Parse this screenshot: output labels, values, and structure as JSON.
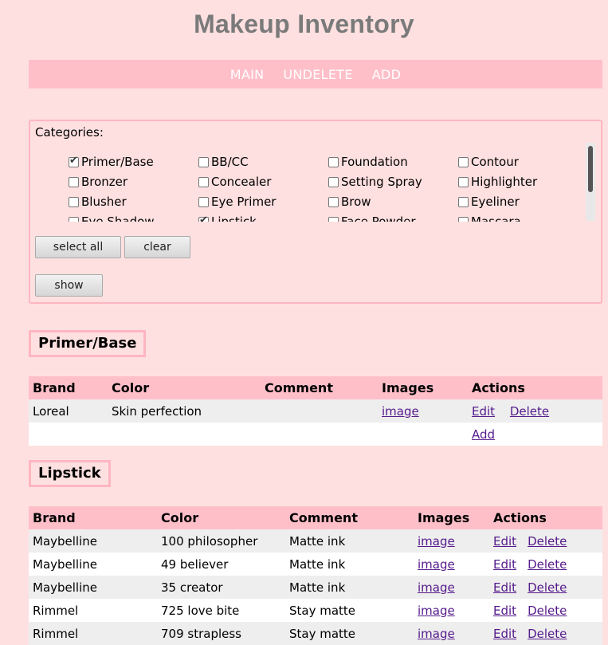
{
  "page": {
    "title": "Makeup Inventory"
  },
  "nav": {
    "items": [
      "MAIN",
      "UNDELETE",
      "ADD"
    ]
  },
  "categories": {
    "label": "Categories:",
    "items": [
      {
        "label": "Primer/Base",
        "checked": true
      },
      {
        "label": "BB/CC",
        "checked": false
      },
      {
        "label": "Foundation",
        "checked": false
      },
      {
        "label": "Contour",
        "checked": false
      },
      {
        "label": "Bronzer",
        "checked": false
      },
      {
        "label": "Concealer",
        "checked": false
      },
      {
        "label": "Setting Spray",
        "checked": false
      },
      {
        "label": "Highlighter",
        "checked": false
      },
      {
        "label": "Blusher",
        "checked": false
      },
      {
        "label": "Eye Primer",
        "checked": false
      },
      {
        "label": "Brow",
        "checked": false
      },
      {
        "label": "Eyeliner",
        "checked": false
      },
      {
        "label": "Eye Shadow",
        "checked": false
      },
      {
        "label": "Lipstick",
        "checked": true
      },
      {
        "label": "Face Powder",
        "checked": false
      },
      {
        "label": "Mascara",
        "checked": false
      }
    ],
    "select_all_label": "select all",
    "clear_label": "clear",
    "show_label": "show"
  },
  "sections": [
    {
      "title": "Primer/Base",
      "headers": [
        "Brand",
        "Color",
        "Comment",
        "Images",
        "Actions"
      ],
      "rows": [
        {
          "brand": "Loreal",
          "color": "Skin perfection",
          "comment": "",
          "image": "image",
          "edit": "Edit",
          "delete": "Delete"
        }
      ],
      "add_label": "Add"
    },
    {
      "title": "Lipstick",
      "headers": [
        "Brand",
        "Color",
        "Comment",
        "Images",
        "Actions"
      ],
      "rows": [
        {
          "brand": "Maybelline",
          "color": "100 philosopher",
          "comment": "Matte ink",
          "image": "image",
          "edit": "Edit",
          "delete": "Delete"
        },
        {
          "brand": "Maybelline",
          "color": "49 believer",
          "comment": "Matte ink",
          "image": "image",
          "edit": "Edit",
          "delete": "Delete"
        },
        {
          "brand": "Maybelline",
          "color": "35 creator",
          "comment": "Matte ink",
          "image": "image",
          "edit": "Edit",
          "delete": "Delete"
        },
        {
          "brand": "Rimmel",
          "color": "725 love bite",
          "comment": "Stay matte",
          "image": "image",
          "edit": "Edit",
          "delete": "Delete"
        },
        {
          "brand": "Rimmel",
          "color": "709 strapless",
          "comment": "Stay matte",
          "image": "image",
          "edit": "Edit",
          "delete": "Delete"
        }
      ]
    }
  ],
  "colors": {
    "background": "#ffe0e0",
    "accent": "#ffbfc9",
    "title": "#7a7a7a",
    "link": "#1a0dab",
    "visited_link": "#551a8b"
  }
}
